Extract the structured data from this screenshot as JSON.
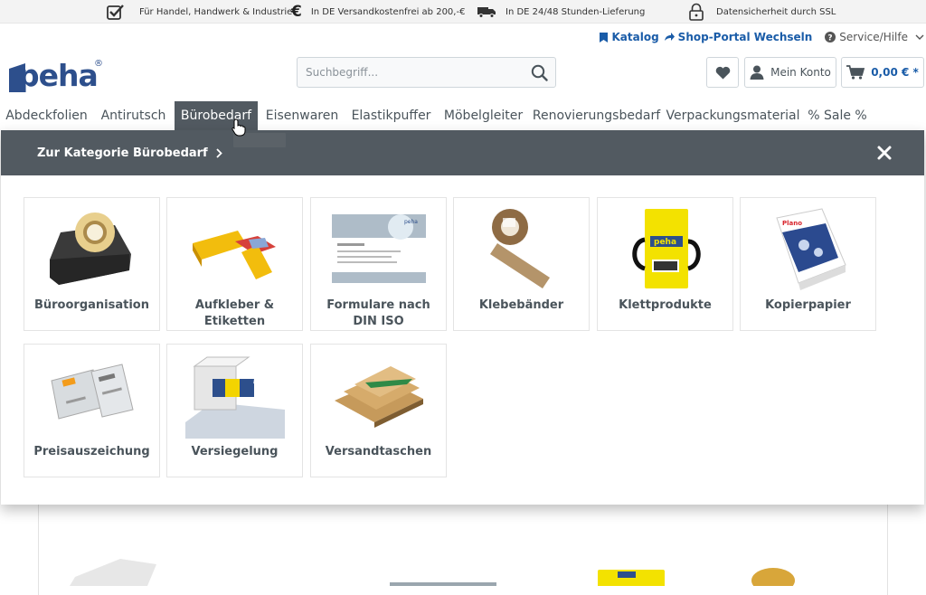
{
  "usp": [
    {
      "icon": "checkbox-check-icon",
      "text": "Für Handel, Handwerk & Industrie"
    },
    {
      "icon": "euro-icon",
      "text": "In DE Versandkostenfrei ab 200,-€"
    },
    {
      "icon": "truck-icon",
      "text": "In DE 24/48 Stunden-Lieferung"
    },
    {
      "icon": "lock-icon",
      "text": "Datensicherheit durch SSL"
    }
  ],
  "service": {
    "catalog": "Katalog",
    "portal": "Shop-Portal Wechseln",
    "help": "Service/Hilfe"
  },
  "logo": {
    "text": "peha",
    "mark": "®"
  },
  "search": {
    "placeholder": "Suchbegriff..."
  },
  "header": {
    "account": "Mein Konto",
    "cart_total": "0,00 € *"
  },
  "nav": [
    "Abdeckfolien",
    "Antirutsch",
    "Bürobedarf",
    "Eisenwaren",
    "Elastikpuffer",
    "Möbelgleiter",
    "Renovierungsbedarf",
    "Verpackungsmaterial",
    "% Sale %"
  ],
  "nav_active": "Bürobedarf",
  "flyout": {
    "title": "Zur Kategorie Bürobedarf",
    "categories": [
      "Büroorganisation",
      "Aufkleber & Etiketten",
      "Formulare nach DIN ISO",
      "Klebebänder",
      "Klettprodukte",
      "Kopierpapier",
      "Preisauszeichung",
      "Versiegelung",
      "Versandtaschen"
    ]
  },
  "colors": {
    "accent": "#1a5ca8",
    "flyout_header": "#525a61",
    "logo": "#2d4f8c"
  }
}
